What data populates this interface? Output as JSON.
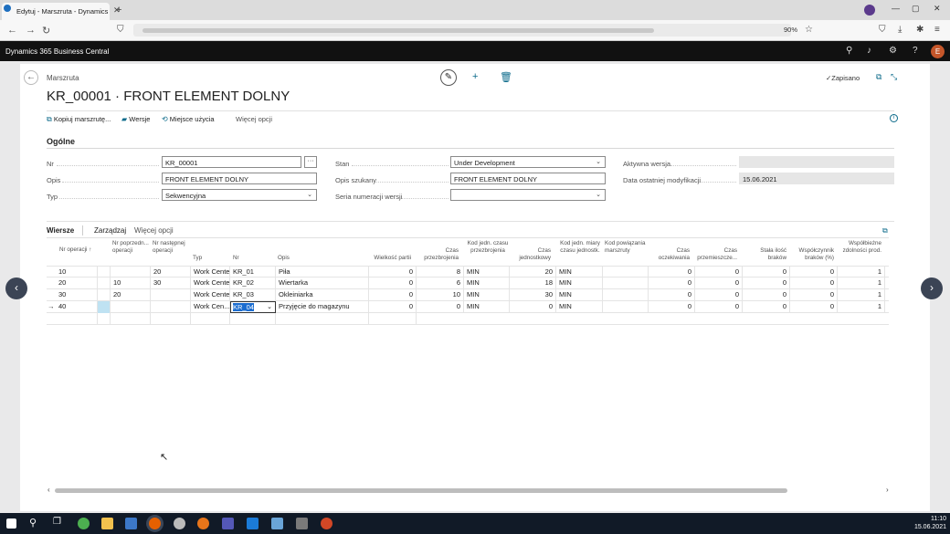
{
  "browser": {
    "tab_title": "Edytuj - Marszruta - Dynamics",
    "zoom": "90%",
    "window_controls": [
      "—",
      "▢",
      "✕"
    ]
  },
  "app": {
    "title": "Dynamics 365 Business Central",
    "avatar_initial": "E"
  },
  "page": {
    "breadcrumb": "Marszruta",
    "title": "KR_00001 · FRONT ELEMENT DOLNY",
    "saved_label": "Zapisano"
  },
  "actions": {
    "copy_label": "Kopiuj marszrutę...",
    "versions_label": "Wersje",
    "where_used_label": "Miejsce użycia",
    "more_label": "Więcej opcji"
  },
  "general": {
    "section_title": "Ogólne",
    "fields": {
      "nr": {
        "label": "Nr",
        "value": "KR_00001"
      },
      "opis": {
        "label": "Opis",
        "value": "FRONT ELEMENT DOLNY"
      },
      "typ": {
        "label": "Typ",
        "value": "Sekwencyjna"
      },
      "stan": {
        "label": "Stan",
        "value": "Under Development"
      },
      "opis_szukany": {
        "label": "Opis szukany",
        "value": "FRONT ELEMENT DOLNY"
      },
      "seria": {
        "label": "Seria numeracji wersji",
        "value": ""
      },
      "aktywna_wersja": {
        "label": "Aktywna wersja",
        "value": ""
      },
      "data_mod": {
        "label": "Data ostatniej modyfikacji",
        "value": "15.06.2021"
      }
    }
  },
  "lines": {
    "tab_lines": "Wiersze",
    "tab_manage": "Zarządzaj",
    "tab_more": "Więcej opcji",
    "headers": {
      "nr_operacji": "Nr operacji ↑",
      "nr_poprzedn": "Nr poprzedn... operacji",
      "nr_nastepnej": "Nr następnej operacji",
      "typ": "Typ",
      "nr": "Nr",
      "opis": "Opis",
      "wielkosc_partii": "Wielkość partii",
      "czas_przezbrojenia": "Czas przezbrojenia",
      "kod_jedn_czasu": "Kod jedn. czasu przezbrojenia",
      "czas_jednostkowy": "Czas jednostkowy",
      "kod_jedn_miary": "Kod jedn. miary czasu jednostk.",
      "kod_powiazania": "Kod powiązania marszruty",
      "czas_oczekiwania": "Czas oczekiwania",
      "czas_przemieszcz": "Czas przemieszcze...",
      "stala_ilosc_brakow": "Stała ilość braków",
      "wspolczynnik_brakow": "Współczynnik braków (%)",
      "wspolbiezne": "Współbieżne zdolności prod."
    },
    "rows": [
      {
        "op": "10",
        "prev": "",
        "next": "20",
        "type": "Work Center",
        "no": "KR_01",
        "desc": "Piła",
        "lot": "0",
        "setup": "8",
        "setup_unit": "MIN",
        "run": "20",
        "run_unit": "MIN",
        "link": "",
        "wait": "0",
        "move": "0",
        "scrap_fixed": "0",
        "scrap_pct": "0",
        "conc": "1"
      },
      {
        "op": "20",
        "prev": "10",
        "next": "30",
        "type": "Work Center",
        "no": "KR_02",
        "desc": "Wiertarka",
        "lot": "0",
        "setup": "6",
        "setup_unit": "MIN",
        "run": "18",
        "run_unit": "MIN",
        "link": "",
        "wait": "0",
        "move": "0",
        "scrap_fixed": "0",
        "scrap_pct": "0",
        "conc": "1"
      },
      {
        "op": "30",
        "prev": "20",
        "next": "",
        "type": "Work Center",
        "no": "KR_03",
        "desc": "Okleiniarka",
        "lot": "0",
        "setup": "10",
        "setup_unit": "MIN",
        "run": "30",
        "run_unit": "MIN",
        "link": "",
        "wait": "0",
        "move": "0",
        "scrap_fixed": "0",
        "scrap_pct": "0",
        "conc": "1"
      },
      {
        "op": "40",
        "prev": "",
        "next": "",
        "type": "Work Cen...",
        "no": "KR_04",
        "desc": "Przyjęcie do magazynu",
        "lot": "0",
        "setup": "0",
        "setup_unit": "MIN",
        "run": "0",
        "run_unit": "MIN",
        "link": "",
        "wait": "0",
        "move": "0",
        "scrap_fixed": "0",
        "scrap_pct": "0",
        "conc": "1"
      }
    ],
    "current_row_marker": "→"
  },
  "taskbar": {
    "time": "11:10",
    "date": "15.06.2021"
  },
  "icons": {
    "accent": "#0b6a8a",
    "nav_dark": "#3b4455",
    "avatar_bg": "#c5562a"
  }
}
